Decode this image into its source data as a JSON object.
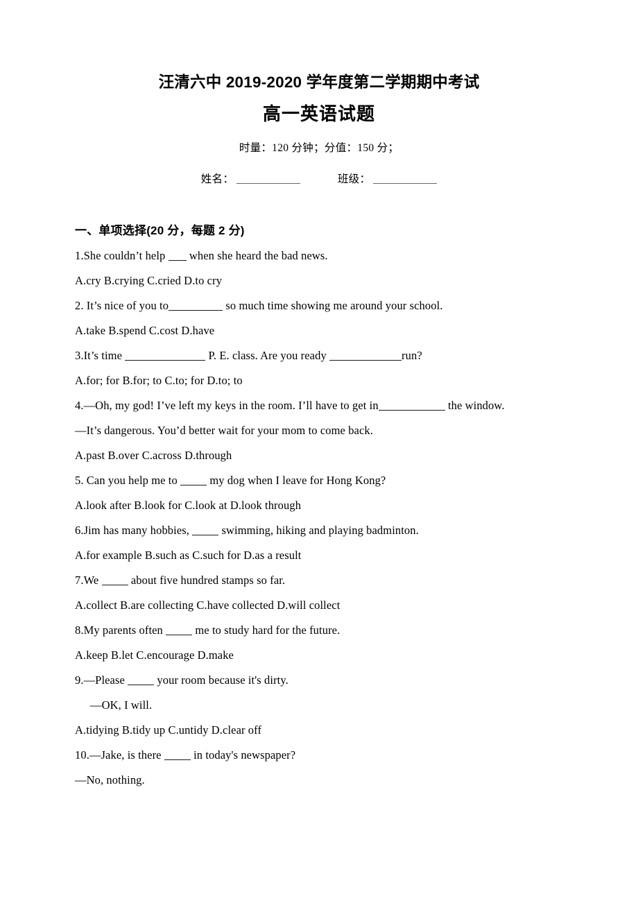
{
  "document": {
    "header": {
      "school_exam_title": "汪清六中 2019-2020 学年度第二学期期中考试",
      "paper_title": "高一英语试题",
      "exam_info": "时量：120 分钟；分值：150 分；",
      "name_label": "姓名：",
      "class_label": "班级："
    },
    "sections": [
      {
        "heading": "一、单项选择(20 分，每题 2 分)",
        "questions": [
          {
            "number": "1.",
            "stem_before": "1.She couldn’t help",
            "stem_after": "when she heard the bad news.",
            "options_line": "A.cry    B.crying      C.cried      D.to cry",
            "options": [
              {
                "letter": "A.",
                "text": "cry"
              },
              {
                "letter": "B.",
                "text": "crying"
              },
              {
                "letter": "C.",
                "text": "cried"
              },
              {
                "letter": "D.",
                "text": "to cry"
              }
            ]
          },
          {
            "number": "2.",
            "stem_before": "2. It’s nice of you to",
            "stem_after": "so much time showing me around your school.",
            "options_line": "A.take    B.spend      C.cost      D.have",
            "options": [
              {
                "letter": "A.",
                "text": "take"
              },
              {
                "letter": "B.",
                "text": "spend"
              },
              {
                "letter": "C.",
                "text": "cost"
              },
              {
                "letter": "D.",
                "text": "have"
              }
            ]
          },
          {
            "number": "3.",
            "stem_before": "3.It’s time",
            "stem_middle": "P. E. class. Are you ready",
            "stem_after": "run?",
            "options_line": "A.for; for   B.for; to   C.to; for    D.to; to",
            "options": [
              {
                "letter": "A.",
                "text": "for; for"
              },
              {
                "letter": "B.",
                "text": "for; to"
              },
              {
                "letter": "C.",
                "text": "to; for"
              },
              {
                "letter": "D.",
                "text": "to; to"
              }
            ]
          },
          {
            "number": "4.",
            "stem_before": "4.—Oh, my god! I’ve left my keys in the room. I’ll have to get in",
            "stem_after": "the window.",
            "dialog_reply": "—It’s dangerous. You’d better wait for your mom to come back.",
            "options_line": "A.past    B.over      C.across      D.through",
            "options": [
              {
                "letter": "A.",
                "text": "past"
              },
              {
                "letter": "B.",
                "text": "over"
              },
              {
                "letter": "C.",
                "text": "across"
              },
              {
                "letter": "D.",
                "text": "through"
              }
            ]
          },
          {
            "number": "5.",
            "stem_before": "5. Can you help me to",
            "stem_after": "my dog when I leave for Hong Kong?",
            "options_line": "A.look after     B.look for      C.look at      D.look through",
            "options": [
              {
                "letter": "A.",
                "text": "look after"
              },
              {
                "letter": "B.",
                "text": "look for"
              },
              {
                "letter": "C.",
                "text": "look at"
              },
              {
                "letter": "D.",
                "text": "look through"
              }
            ]
          },
          {
            "number": "6.",
            "stem_before": "6.Jim has many hobbies,",
            "stem_after": "swimming, hiking and playing badminton.",
            "options_line": "A.for example     B.such as    C.such for      D.as a result",
            "options": [
              {
                "letter": "A.",
                "text": "for example"
              },
              {
                "letter": "B.",
                "text": "such as"
              },
              {
                "letter": "C.",
                "text": "such for"
              },
              {
                "letter": "D.",
                "text": "as a result"
              }
            ]
          },
          {
            "number": "7.",
            "stem_before": "7.We",
            "stem_after": "about five hundred stamps so far.",
            "options_line": "A.collect    B.are collecting     C.have collected     D.will collect",
            "options": [
              {
                "letter": "A.",
                "text": "collect"
              },
              {
                "letter": "B.",
                "text": "are collecting"
              },
              {
                "letter": "C.",
                "text": "have collected"
              },
              {
                "letter": "D.",
                "text": "will collect"
              }
            ]
          },
          {
            "number": "8.",
            "stem_before": "8.My parents often",
            "stem_after": "me to study hard for the future.",
            "options_line": "A.keep     B.let     C.encourage       D.make",
            "options": [
              {
                "letter": "A.",
                "text": "keep"
              },
              {
                "letter": "B.",
                "text": "let"
              },
              {
                "letter": "C.",
                "text": "encourage"
              },
              {
                "letter": "D.",
                "text": "make"
              }
            ]
          },
          {
            "number": "9.",
            "stem_before": "9.—Please",
            "stem_after": "your room because it's dirty.",
            "dialog_reply": "—OK, I will.",
            "options_line": "A.tidying      B.tidy up    C.untidy      D.clear off",
            "options": [
              {
                "letter": "A.",
                "text": "tidying"
              },
              {
                "letter": "B.",
                "text": "tidy up"
              },
              {
                "letter": "C.",
                "text": "untidy"
              },
              {
                "letter": "D.",
                "text": "clear off"
              }
            ]
          },
          {
            "number": "10.",
            "stem_before": "10.—Jake, is there",
            "stem_after": "in today's newspaper?",
            "dialog_reply": "—No, nothing."
          }
        ]
      }
    ]
  }
}
